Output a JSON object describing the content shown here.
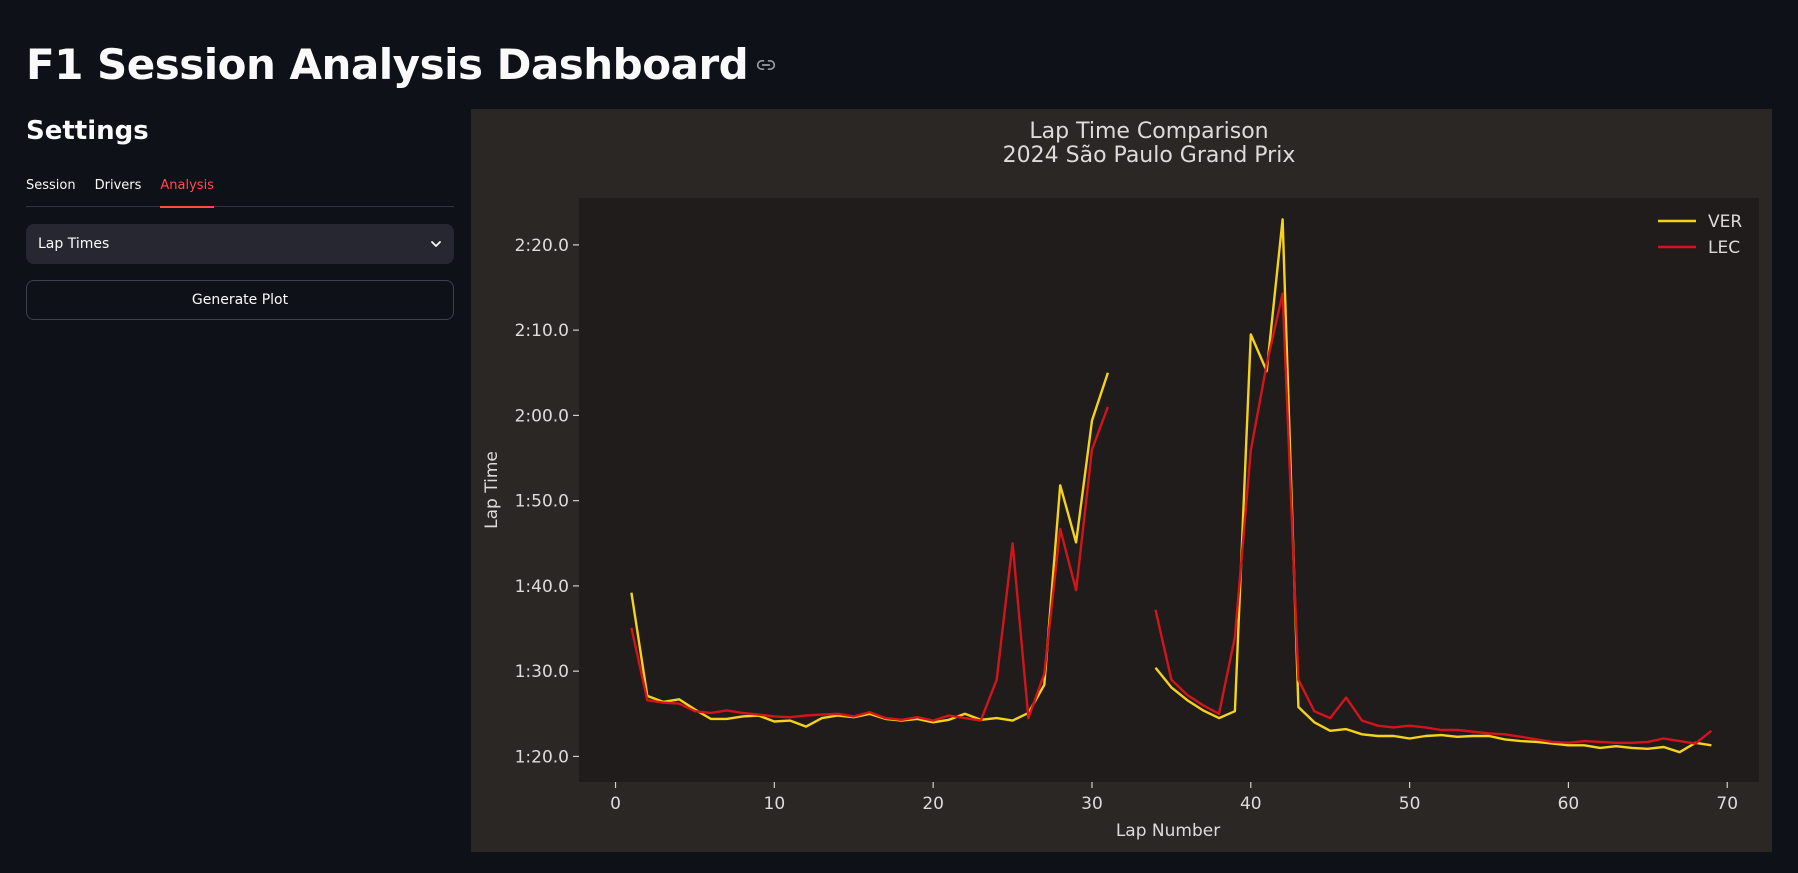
{
  "header": {
    "title": "F1 Session Analysis Dashboard"
  },
  "sidebar": {
    "title": "Settings",
    "tabs": [
      {
        "label": "Session"
      },
      {
        "label": "Drivers"
      },
      {
        "label": "Analysis"
      }
    ],
    "active_tab": "Analysis",
    "select_value": "Lap Times",
    "button_label": "Generate Plot"
  },
  "colors": {
    "accent": "#ff4b4b",
    "background": "#0e1117",
    "panel": "#2b2725",
    "plot_bg": "#1f1c1b"
  },
  "chart_data": {
    "type": "line",
    "title": "Lap Time Comparison",
    "subtitle": "2024 São Paulo Grand Prix",
    "xlabel": "Lap Number",
    "ylabel": "Lap Time",
    "xlim": [
      -2.3,
      72
    ],
    "ylim": [
      77,
      145.5
    ],
    "xticks": [
      0,
      10,
      20,
      30,
      40,
      50,
      60,
      70
    ],
    "yticks": [
      {
        "value": 80,
        "label": "1:20.0"
      },
      {
        "value": 90,
        "label": "1:30.0"
      },
      {
        "value": 100,
        "label": "1:40.0"
      },
      {
        "value": 110,
        "label": "1:50.0"
      },
      {
        "value": 120,
        "label": "2:00.0"
      },
      {
        "value": 130,
        "label": "2:10.0"
      },
      {
        "value": 140,
        "label": "2:20.0"
      }
    ],
    "grid": false,
    "legend": "top-right",
    "series": [
      {
        "name": "VER",
        "color": "#f5d21b",
        "points": [
          [
            1,
            99.2
          ],
          [
            2,
            87.1
          ],
          [
            3,
            86.4
          ],
          [
            4,
            86.7
          ],
          [
            5,
            85.5
          ],
          [
            6,
            84.4
          ],
          [
            7,
            84.4
          ],
          [
            8,
            84.7
          ],
          [
            9,
            84.8
          ],
          [
            10,
            84.1
          ],
          [
            11,
            84.2
          ],
          [
            12,
            83.5
          ],
          [
            13,
            84.5
          ],
          [
            14,
            84.8
          ],
          [
            15,
            84.6
          ],
          [
            16,
            85.0
          ],
          [
            17,
            84.4
          ],
          [
            18,
            84.2
          ],
          [
            19,
            84.4
          ],
          [
            20,
            84.0
          ],
          [
            21,
            84.3
          ],
          [
            22,
            85.0
          ],
          [
            23,
            84.3
          ],
          [
            24,
            84.5
          ],
          [
            25,
            84.2
          ],
          [
            26,
            85.1
          ],
          [
            27,
            88.4
          ],
          [
            28,
            111.8
          ],
          [
            29,
            105.1
          ],
          [
            30,
            119.4
          ],
          [
            31,
            125.0
          ],
          null,
          [
            34,
            90.4
          ],
          [
            35,
            88.1
          ],
          [
            36,
            86.6
          ],
          [
            37,
            85.4
          ],
          [
            38,
            84.5
          ],
          [
            39,
            85.3
          ],
          [
            40,
            129.5
          ],
          [
            41,
            125.2
          ],
          [
            42,
            143.0
          ],
          [
            43,
            85.8
          ],
          [
            44,
            84.0
          ],
          [
            45,
            83.0
          ],
          [
            46,
            83.2
          ],
          [
            47,
            82.6
          ],
          [
            48,
            82.4
          ],
          [
            49,
            82.4
          ],
          [
            50,
            82.1
          ],
          [
            51,
            82.4
          ],
          [
            52,
            82.5
          ],
          [
            53,
            82.3
          ],
          [
            54,
            82.4
          ],
          [
            55,
            82.4
          ],
          [
            56,
            82.0
          ],
          [
            57,
            81.8
          ],
          [
            58,
            81.7
          ],
          [
            59,
            81.5
          ],
          [
            60,
            81.3
          ],
          [
            61,
            81.3
          ],
          [
            62,
            81.0
          ],
          [
            63,
            81.2
          ],
          [
            64,
            81.0
          ],
          [
            65,
            80.9
          ],
          [
            66,
            81.1
          ],
          [
            67,
            80.5
          ],
          [
            68,
            81.6
          ],
          [
            69,
            81.3
          ]
        ]
      },
      {
        "name": "LEC",
        "color": "#d4141b",
        "points": [
          [
            1,
            95.1
          ],
          [
            2,
            86.6
          ],
          [
            3,
            86.3
          ],
          [
            4,
            86.2
          ],
          [
            5,
            85.3
          ],
          [
            6,
            85.1
          ],
          [
            7,
            85.4
          ],
          [
            8,
            85.1
          ],
          [
            9,
            84.9
          ],
          [
            10,
            84.7
          ],
          [
            11,
            84.6
          ],
          [
            12,
            84.8
          ],
          [
            13,
            84.9
          ],
          [
            14,
            85.0
          ],
          [
            15,
            84.7
          ],
          [
            16,
            85.2
          ],
          [
            17,
            84.5
          ],
          [
            18,
            84.3
          ],
          [
            19,
            84.6
          ],
          [
            20,
            84.2
          ],
          [
            21,
            84.8
          ],
          [
            22,
            84.5
          ],
          [
            23,
            84.2
          ],
          [
            24,
            89.0
          ],
          [
            25,
            105.0
          ],
          [
            26,
            84.5
          ],
          [
            27,
            89.7
          ],
          [
            28,
            106.7
          ],
          [
            29,
            99.5
          ],
          [
            30,
            116.0
          ],
          [
            31,
            121.0
          ],
          null,
          [
            34,
            97.2
          ],
          [
            35,
            89.0
          ],
          [
            36,
            87.2
          ],
          [
            37,
            86.0
          ],
          [
            38,
            85.0
          ],
          [
            39,
            94.0
          ],
          [
            40,
            115.9
          ],
          [
            41,
            126.0
          ],
          [
            42,
            134.3
          ],
          [
            43,
            89.0
          ],
          [
            44,
            85.3
          ],
          [
            45,
            84.5
          ],
          [
            46,
            86.9
          ],
          [
            47,
            84.2
          ],
          [
            48,
            83.6
          ],
          [
            49,
            83.4
          ],
          [
            50,
            83.6
          ],
          [
            51,
            83.4
          ],
          [
            52,
            83.1
          ],
          [
            53,
            83.1
          ],
          [
            54,
            82.9
          ],
          [
            55,
            82.7
          ],
          [
            56,
            82.6
          ],
          [
            57,
            82.3
          ],
          [
            58,
            82.0
          ],
          [
            59,
            81.7
          ],
          [
            60,
            81.6
          ],
          [
            61,
            81.8
          ],
          [
            62,
            81.7
          ],
          [
            63,
            81.6
          ],
          [
            64,
            81.6
          ],
          [
            65,
            81.7
          ],
          [
            66,
            82.1
          ],
          [
            67,
            81.8
          ],
          [
            68,
            81.5
          ],
          [
            69,
            83.0
          ]
        ]
      }
    ]
  }
}
